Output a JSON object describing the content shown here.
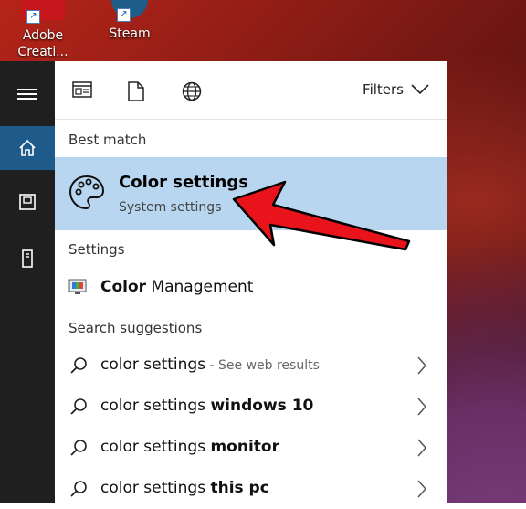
{
  "desktop": {
    "icons": [
      {
        "label_line1": "Adobe",
        "label_line2": "Creati..."
      },
      {
        "label_line1": "Steam",
        "label_line2": ""
      }
    ]
  },
  "toolbar": {
    "filters_label": "Filters"
  },
  "results": {
    "best_match_heading": "Best match",
    "best_match_title": "Color settings",
    "best_match_subtitle": "System settings",
    "settings_heading": "Settings",
    "settings_item_bold": "Color",
    "settings_item_rest": " Management",
    "suggestions_heading": "Search suggestions",
    "suggestions": [
      {
        "prefix": "color settings",
        "bold": "",
        "hint": " - See web results"
      },
      {
        "prefix": "color settings ",
        "bold": "windows 10",
        "hint": ""
      },
      {
        "prefix": "color settings ",
        "bold": "monitor",
        "hint": ""
      },
      {
        "prefix": "color settings ",
        "bold": "this pc",
        "hint": ""
      }
    ]
  },
  "colors": {
    "highlight": "#b8d6f0",
    "rail": "#1f1f1f",
    "rail_active": "#1e5a8a",
    "arrow": "#e8131b"
  },
  "icons": {
    "rail": [
      "hamburger-icon",
      "home-icon",
      "document-icon",
      "tower-icon"
    ],
    "toolbar": [
      "apps-icon",
      "document-icon",
      "globe-icon",
      "chevron-down-icon"
    ],
    "best_match": "palette-icon",
    "settings_item": "monitor-icon",
    "suggestion": "search-icon",
    "suggestion_arrow": "chevron-right-icon"
  }
}
